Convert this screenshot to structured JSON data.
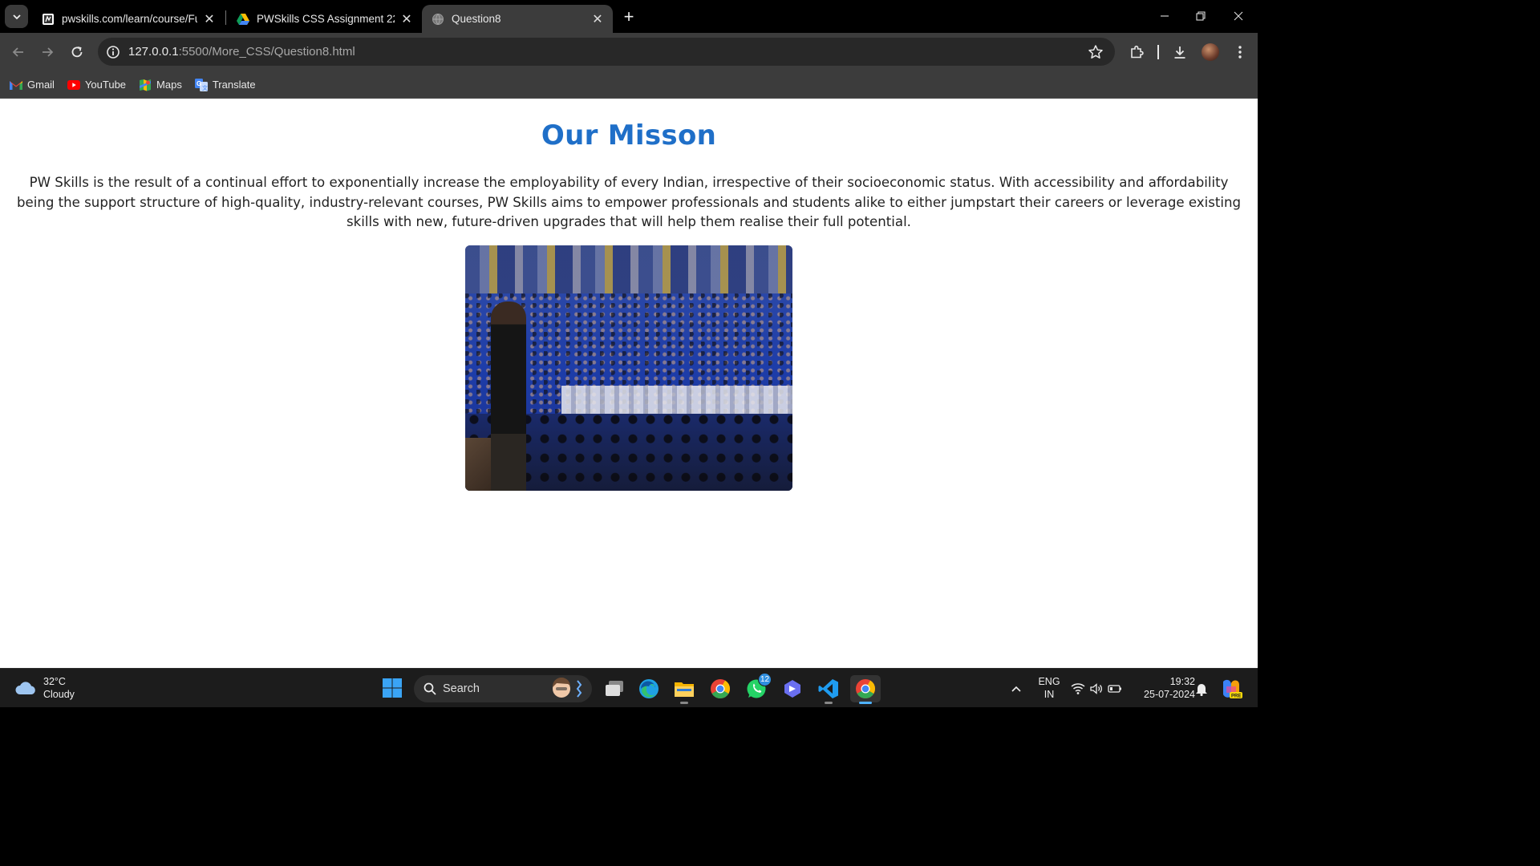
{
  "browser": {
    "tabs": [
      {
        "title": "pwskills.com/learn/course/Full-S",
        "active": false
      },
      {
        "title": "PWSkills CSS Assignment 22 Ma",
        "active": false
      },
      {
        "title": "Question8",
        "active": true
      }
    ],
    "url_host": "127.0.0.1",
    "url_path": ":5500/More_CSS/Question8.html",
    "bookmarks": [
      "Gmail",
      "YouTube",
      "Maps",
      "Translate"
    ]
  },
  "page": {
    "title": "Our Misson",
    "paragraph": "PW Skills is the result of a continual effort to exponentially increase the employability of every Indian, irrespective of their socioeconomic status. With accessibility and affordability being the support structure of high-quality, industry-relevant courses, PW Skills aims to empower professionals and students alike to either jumpstart their careers or leverage existing skills with new, future-driven upgrades that will help them realise their full potential."
  },
  "taskbar": {
    "weather_temp": "32°C",
    "weather_desc": "Cloudy",
    "search_label": "Search",
    "whatsapp_badge": "12",
    "lang_top": "ENG",
    "lang_bottom": "IN",
    "time": "19:32",
    "date": "25-07-2024"
  },
  "colors": {
    "accent_title": "#1f6fc8",
    "chrome_bg": "#3c3c3c",
    "taskbar_bg": "#1c1c1c"
  }
}
